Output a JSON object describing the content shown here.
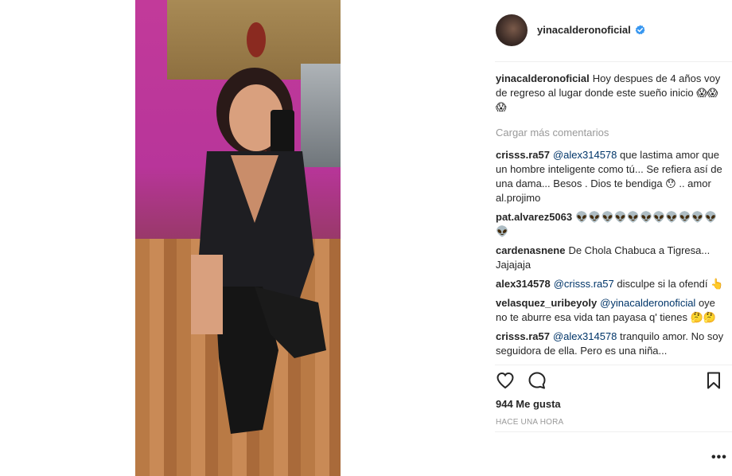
{
  "post": {
    "author": "yinacalderonoficial",
    "verified": true,
    "caption_author": "yinacalderonoficial",
    "caption": "Hoy despues de 4 años voy de regreso al lugar donde este sueño inicio 😱😱😱",
    "load_more": "Cargar más comentarios",
    "likes": "944 Me gusta",
    "time_ago": "HACE UNA HORA",
    "more_options": "•••"
  },
  "comments": [
    {
      "user": "crisss.ra57",
      "mention": "@alex314578",
      "text": " que lastima amor que un hombre inteligente como tú... Se refiera así de una dama... Besos . Dios te bendiga 😯 .. amor al.projimo"
    },
    {
      "user": "pat.alvarez5063",
      "mention": "",
      "text": "👽👽👽👽👽👽👽👽👽👽👽👽"
    },
    {
      "user": "cardenasnene",
      "mention": "",
      "text": "De Chola Chabuca a Tigresa... Jajajaja"
    },
    {
      "user": "alex314578",
      "mention": "@crisss.ra57",
      "text": " disculpe si la ofendí 👆"
    },
    {
      "user": "velasquez_uribeyoly",
      "mention": "@yinacalderonoficial",
      "text": " oye no te aburre esa vida tan payasa q' tienes 🤔🤔"
    },
    {
      "user": "crisss.ra57",
      "mention": "@alex314578",
      "text": " tranquilo amor. No soy seguidora de ella. Pero es una niña..."
    }
  ],
  "icons": {
    "like": "heart-icon",
    "comment": "comment-bubble-icon",
    "save": "bookmark-icon",
    "verified": "verified-badge-icon"
  },
  "colors": {
    "link": "#003569",
    "muted": "#999999",
    "verified": "#3897f0",
    "text": "#262626"
  }
}
